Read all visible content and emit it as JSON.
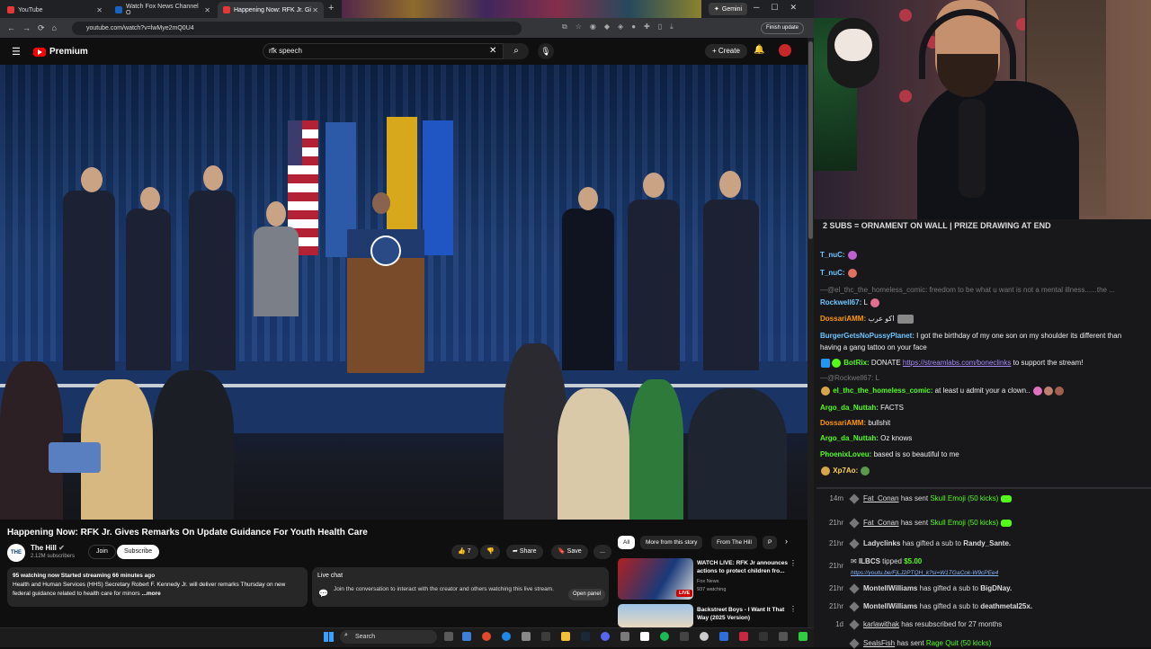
{
  "browser": {
    "tabs": [
      {
        "label": "YouTube",
        "fav": "#e53935"
      },
      {
        "label": "Watch Fox News Channel O",
        "fav": "#1565c0"
      },
      {
        "label": "Happening Now: RFK Jr. Gi",
        "fav": "#e53935"
      }
    ],
    "new_tab": "+",
    "gemini": "Gemini",
    "url": "youtube.com/watch?v=lwMye2mQ0U4",
    "finish_update": "Finish update"
  },
  "yt": {
    "logo": "Premium",
    "search_value": "rfk speech",
    "create": "Create",
    "title": "Happening Now: RFK Jr. Gives Remarks On Update Guidance For Youth Health Care",
    "channel": "The Hill",
    "channel_logo": "THE HILL",
    "subs": "2.12M subscribers",
    "join": "Join",
    "subscribe": "Subscribe",
    "likes": "7",
    "share": "Share",
    "save": "Save",
    "more": "...",
    "desc_header": "95 watching now  Started streaming 66 minutes ago",
    "desc_text": "Health and Human Services (HHS) Secretary Robert F. Kennedy Jr. will deliver remarks Thursday on new federal guidance related to health care for minors",
    "desc_more": "...more",
    "live_chat_title": "Live chat",
    "live_chat_text": "Join the conversation to interact with the creator and others watching this live stream.",
    "open_panel": "Open panel",
    "chips": [
      "All",
      "More from this story",
      "From The Hill",
      "P"
    ],
    "recos": [
      {
        "title": "WATCH LIVE: RFK Jr announces actions to protect children fro...",
        "channel": "Fox News",
        "views": "937 watching",
        "badge": "LIVE"
      },
      {
        "title": "Backstreet Boys - I Want It That Way (2025 Version)",
        "channel": "",
        "views": "",
        "badge": ""
      }
    ]
  },
  "taskbar": {
    "search": "Search"
  },
  "stream": {
    "banner": "2 SUBS = ORNAMENT ON WALL | PRIZE DRAWING AT END",
    "chat": [
      {
        "user": "T_nuC:",
        "text": "",
        "color": "#6ec6ff",
        "faded": false
      },
      {
        "user": "T_nuC:",
        "text": "",
        "color": "#6ec6ff",
        "faded": false
      },
      {
        "user": "—@el_thc_the_homeless_comic:",
        "text": "freedom to be what u want is not a mental illness......the ...",
        "color": "#777",
        "faded": true
      },
      {
        "user": "Rockwell67:",
        "text": "L",
        "color": "#6ec6ff",
        "faded": false
      },
      {
        "user": "DossariAMM:",
        "text": "اكو عرب",
        "color": "#ff9800",
        "faded": false
      },
      {
        "user": "BurgerGetsNoPussyPlanet:",
        "text": "I got the birthday of my one son on my shoulder its different than",
        "color": "#6ec6ff",
        "faded": false
      },
      {
        "user": "",
        "text": "having a gang tattoo on your face",
        "color": "",
        "faded": false
      },
      {
        "user": "BotRix:",
        "text": "DONATE",
        "color": "#53fc18",
        "faded": false,
        "link": "https://streamlabs.com/boneclinks",
        "after": "to support the stream!"
      },
      {
        "user": "—@Rockwell67:",
        "text": "L",
        "color": "#777",
        "faded": true
      },
      {
        "user": "el_thc_the_homeless_comic:",
        "text": "at least u admit your a clown..",
        "color": "#53fc18",
        "faded": false
      },
      {
        "user": "Argo_da_Nuttah:",
        "text": "FACTS",
        "color": "#53fc18",
        "faded": false
      },
      {
        "user": "DossariAMM:",
        "text": "bullshit",
        "color": "#ff9800",
        "faded": false
      },
      {
        "user": "Argo_da_Nuttah:",
        "text": "Oz knows",
        "color": "#53fc18",
        "faded": false
      },
      {
        "user": "PhoenixLoveu:",
        "text": "based is so beautiful to me",
        "color": "#53fc18",
        "faded": false
      },
      {
        "user": "Xp7Ao:",
        "text": "",
        "color": "#ffd54f",
        "faded": false
      }
    ],
    "events": [
      {
        "time": "14m",
        "name": "Fat_Conan",
        "action": "has sent",
        "item": "Skull Emoji (50 kicks)",
        "kick": true
      },
      {
        "time": "21hr",
        "name": "Fat_Conan",
        "action": "has sent",
        "item": "Skull Emoji (50 kicks)",
        "kick": true
      },
      {
        "time": "21hr",
        "name": "Ladyclinks",
        "action": "has gifted a sub to",
        "item": "Randy_Sante.",
        "kick": false
      },
      {
        "time": "21hr",
        "name": "ILBCS",
        "action": "tipped",
        "item": "$5.00",
        "kick": false,
        "link": "https://youtu.be/FjLJ2PTQH_k?si=W1TGaCok-W9cPEe4"
      },
      {
        "time": "21hr",
        "name": "MontellWilliams",
        "action": "has gifted a sub to",
        "item": "BigDNay.",
        "kick": false
      },
      {
        "time": "21hr",
        "name": "MontellWilliams",
        "action": "has gifted a sub to",
        "item": "deathmetal25x.",
        "kick": false
      },
      {
        "time": "1d",
        "name": "karlawithak",
        "action": "has resubscribed for 27 months",
        "item": "",
        "kick": false
      },
      {
        "time": "",
        "name": "SealsFish",
        "action": "has sent",
        "item": "Rage Quit (50 kicks)",
        "kick": true
      }
    ]
  }
}
